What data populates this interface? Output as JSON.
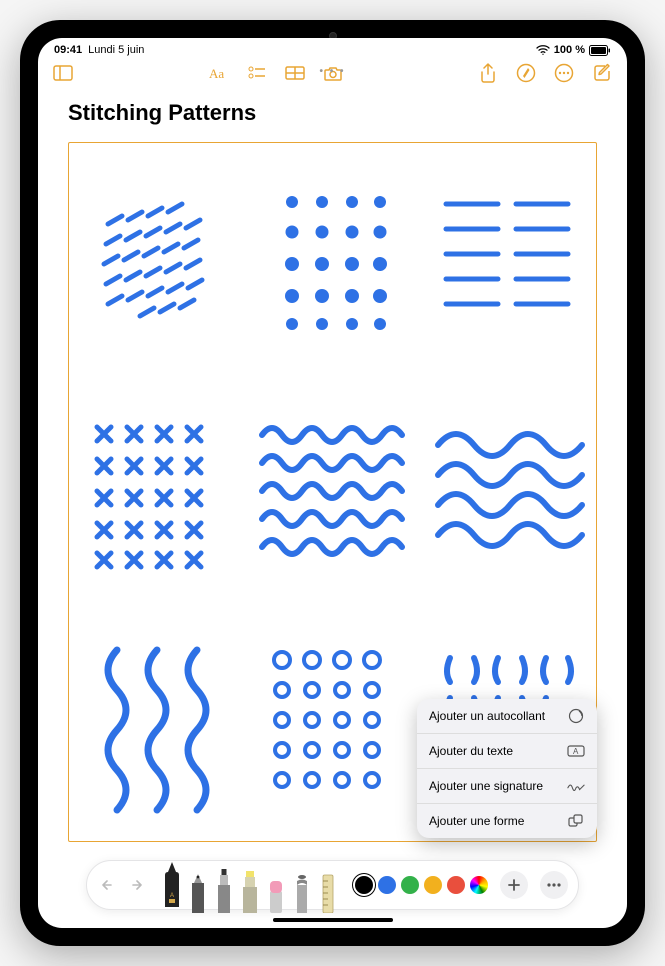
{
  "status": {
    "time": "09:41",
    "date": "Lundi 5 juin",
    "battery": "100 %"
  },
  "note": {
    "title": "Stitching Patterns"
  },
  "popover": {
    "items": [
      {
        "label": "Ajouter un autocollant",
        "icon": "sticker-icon"
      },
      {
        "label": "Ajouter du texte",
        "icon": "textbox-icon"
      },
      {
        "label": "Ajouter une signature",
        "icon": "signature-icon"
      },
      {
        "label": "Ajouter une forme",
        "icon": "shapes-icon"
      }
    ]
  },
  "colors": {
    "stroke": "#2e71e5",
    "accent": "#e8a534",
    "swatches": [
      "#000000",
      "#2e71e5",
      "#33b14a",
      "#f2b01e",
      "#e94f3d"
    ],
    "selected": "#000000"
  },
  "tools": {
    "items": [
      "pen",
      "pencil",
      "marker",
      "highlighter",
      "eraser",
      "crayon",
      "ruler"
    ],
    "selected": "pen"
  }
}
